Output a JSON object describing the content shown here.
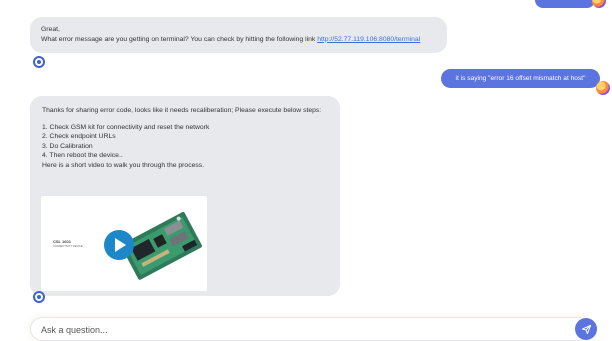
{
  "colors": {
    "accent": "#5b74e0",
    "bot_bubble": "#e7e9ed",
    "link": "#3b6fd8",
    "play": "#1c87c9"
  },
  "messages": [
    {
      "role": "bot",
      "lines": [
        "Great,",
        "What error message are you getting on terminal? You can check by hitting the following link "
      ],
      "link_text": "http://52.77.119.106:8080/terminal"
    },
    {
      "role": "user",
      "text": "it is saying \"error 16 offset mismatch at host\""
    },
    {
      "role": "bot",
      "intro": "Thanks for sharing error code, looks like it needs recaliberation; Please execute below steps:",
      "steps": [
        "1. Check GSM kit for connectivity and reset the network",
        "2. Check endpoint URLs",
        "3. Do Calibration",
        "4. Then reboot the device.."
      ],
      "outro": "Here is a short video to walk you through the process.",
      "video": {
        "title": "CSL 1601",
        "subtitle": "CONNECTIVITY DEVICE",
        "icon": "play-icon"
      }
    }
  ],
  "composer": {
    "placeholder": "Ask a question...",
    "send_icon": "send-icon"
  }
}
